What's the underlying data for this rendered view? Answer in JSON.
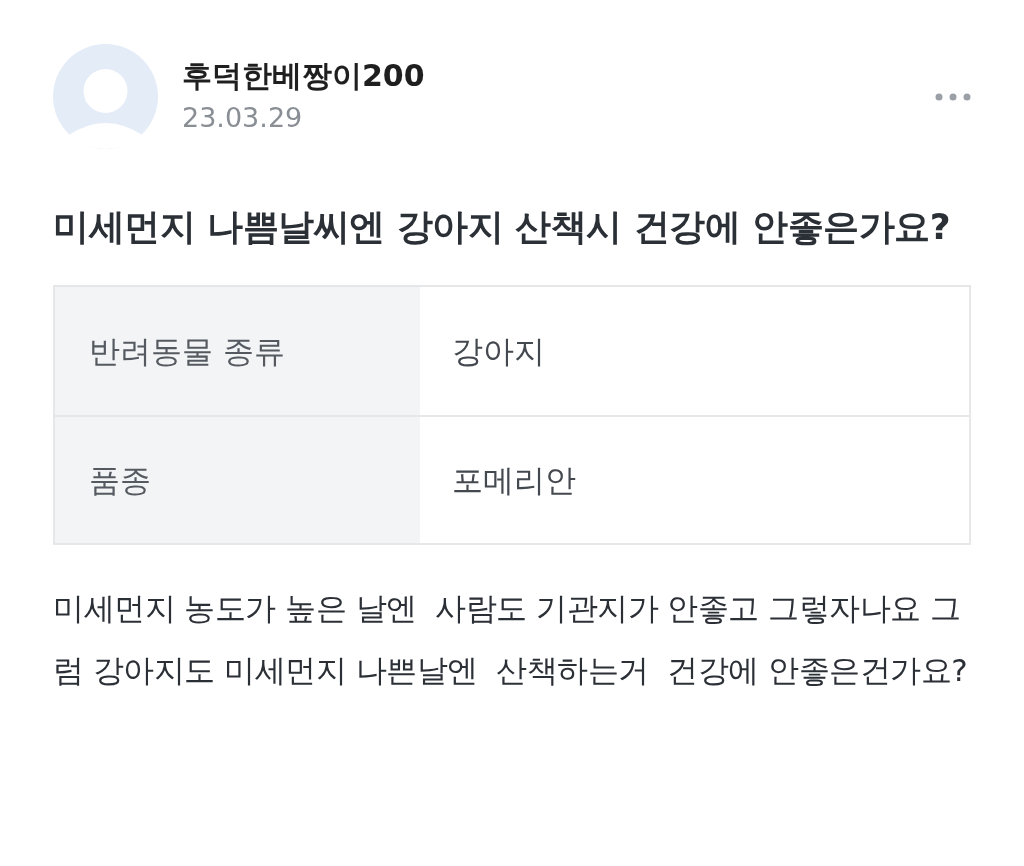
{
  "post": {
    "author": {
      "name": "후덕한베짱이200",
      "date": "23.03.29"
    },
    "title": "미세먼지 나쁨날씨엔 강아지 산책시 건강에 안좋은가요?",
    "info_table": [
      {
        "label": "반려동물 종류",
        "value": "강아지"
      },
      {
        "label": "품종",
        "value": "포메리안"
      }
    ],
    "body": "미세먼지 농도가 높은 날엔  사람도 기관지가 안좋고 그렇자나요 그럼 강아지도 미세먼지 나쁜날엔  산책하는거  건강에 안좋은건가요?"
  }
}
